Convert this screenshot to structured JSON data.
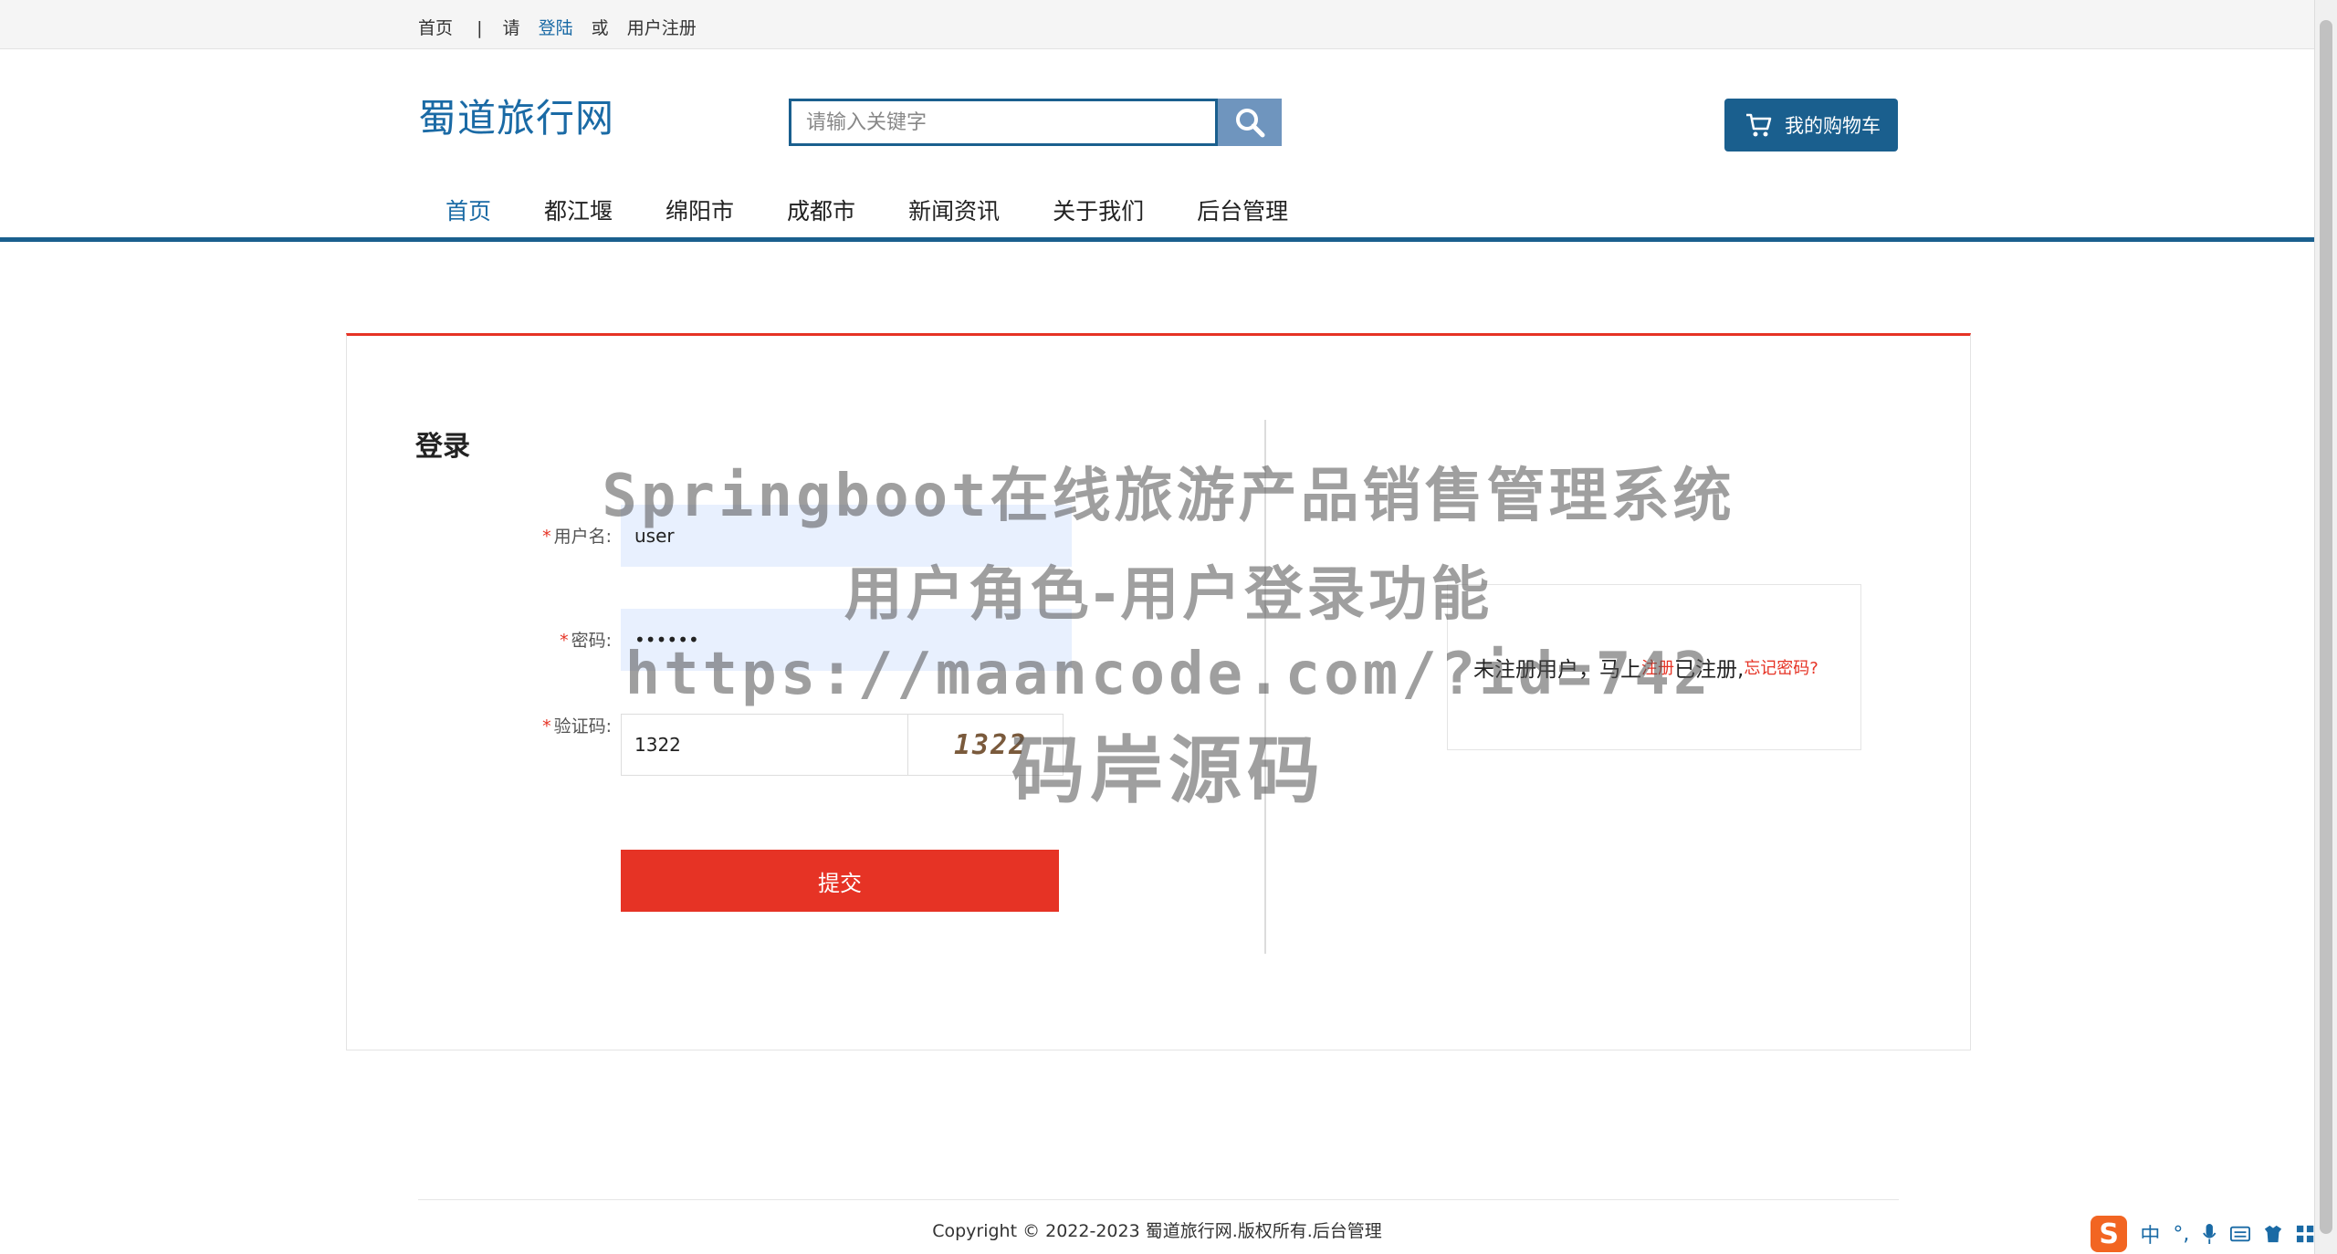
{
  "topbar": {
    "home": "首页",
    "separator": "|",
    "please": "请",
    "login": "登陆",
    "or": "或",
    "register": "用户注册"
  },
  "header": {
    "logo": "蜀道旅行网",
    "search_placeholder": "请输入关键字",
    "cart_label": "我的购物车"
  },
  "nav": {
    "items": [
      "首页",
      "都江堰",
      "绵阳市",
      "成都市",
      "新闻资讯",
      "关于我们",
      "后台管理"
    ],
    "active_index": 0
  },
  "login": {
    "title": "登录",
    "username_label": "用户名:",
    "username_value": "user",
    "password_label": "密码:",
    "password_value": "••••••",
    "captcha_label": "验证码:",
    "captcha_value": "1322",
    "captcha_image_text": "1322",
    "submit_label": "提交",
    "required_mark": "*"
  },
  "register_box": {
    "text_unregistered": "未注册用户，马上",
    "register_link": "注册",
    "text_registered": " 已注册,",
    "forgot_link": "忘记密码?"
  },
  "watermark": {
    "line1": "Springboot在线旅游产品销售管理系统",
    "line2": "用户角色-用户登录功能",
    "line3": "https://maancode.com/?id=742",
    "line4": "码岸源码"
  },
  "footer": {
    "copyright": "Copyright © 2022-2023 蜀道旅行网.版权所有.后台管理"
  },
  "ime": {
    "lang": "中",
    "punct": "°,"
  },
  "colors": {
    "primary": "#1a5f8e",
    "link": "#1a6aa5",
    "accent_red": "#e63325",
    "autofill_bg": "#e8f0fe"
  }
}
